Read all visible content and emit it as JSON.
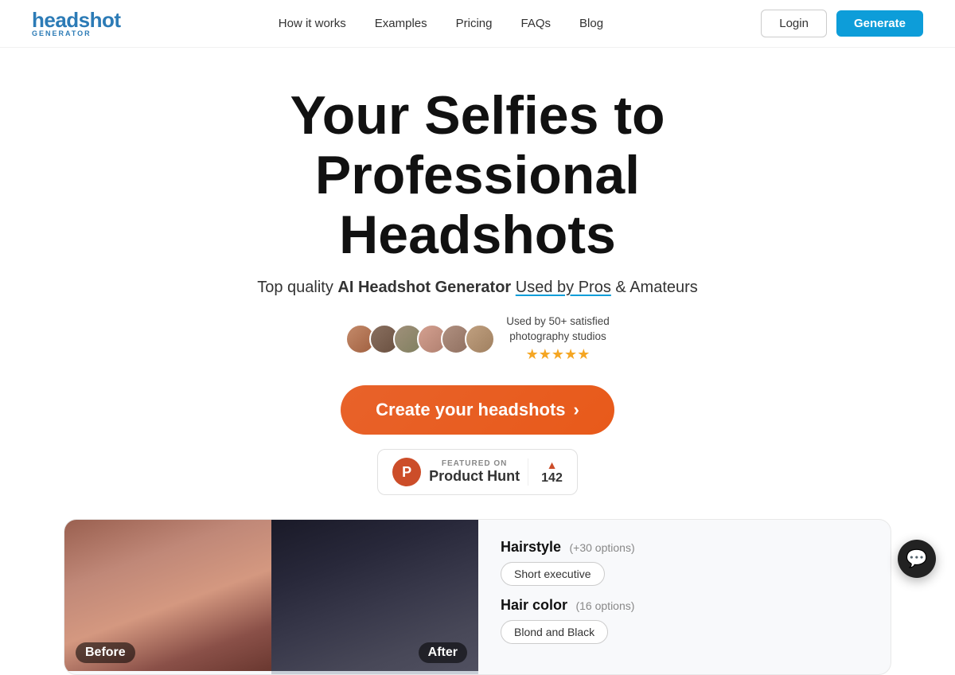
{
  "nav": {
    "logo_headshot": "headshot",
    "logo_generator": "GENERATOR",
    "links": [
      {
        "label": "How it works",
        "id": "how-it-works"
      },
      {
        "label": "Examples",
        "id": "examples"
      },
      {
        "label": "Pricing",
        "id": "pricing"
      },
      {
        "label": "FAQs",
        "id": "faqs"
      },
      {
        "label": "Blog",
        "id": "blog"
      }
    ],
    "login_label": "Login",
    "generate_label": "Generate"
  },
  "hero": {
    "title_line1": "Your Selfies to Professional",
    "title_line2": "Headshots",
    "subtitle_prefix": "Top quality ",
    "subtitle_bold": "AI Headshot Generator",
    "subtitle_link": "Used by Pros",
    "subtitle_suffix": " & Amateurs",
    "proof_text_line1": "Used by 50+ satisfied",
    "proof_text_line2": "photography studios",
    "stars": "★★★★★",
    "cta_label": "Create your headshots",
    "cta_arrow": "›"
  },
  "product_hunt": {
    "icon_letter": "P",
    "featured_label": "FEATURED ON",
    "name": "Product Hunt",
    "vote_count": "142"
  },
  "demo": {
    "before_label": "Before",
    "after_label": "After",
    "hairstyle_title": "Hairstyle",
    "hairstyle_count": "(+30 options)",
    "hairstyle_tag": "Short executive",
    "hair_color_title": "Hair color",
    "hair_color_count": "(16 options)",
    "hair_color_tag": "Blond and Black"
  },
  "chat": {
    "icon": "💬"
  }
}
